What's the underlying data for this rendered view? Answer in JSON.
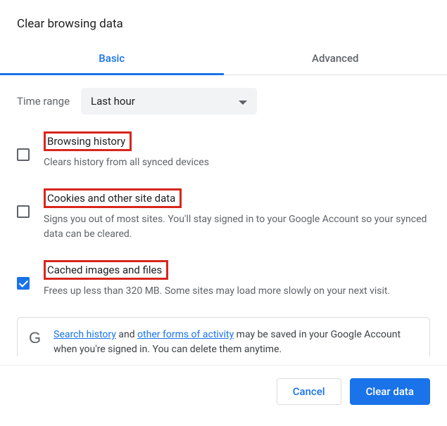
{
  "title": "Clear browsing data",
  "tabs": {
    "basic": "Basic",
    "advanced": "Advanced"
  },
  "timeRange": {
    "label": "Time range",
    "value": "Last hour"
  },
  "items": [
    {
      "title": "Browsing history",
      "desc": "Clears history from all synced devices",
      "checked": false
    },
    {
      "title": "Cookies and other site data",
      "desc": "Signs you out of most sites. You'll stay signed in to your Google Account so your synced data can be cleared.",
      "checked": false
    },
    {
      "title": "Cached images and files",
      "desc": "Frees up less than 320 MB. Some sites may load more slowly on your next visit.",
      "checked": true
    }
  ],
  "info": {
    "link1": "Search history",
    "mid1": " and ",
    "link2": "other forms of activity",
    "mid2": " may be saved in your Google Account when you're signed in. You can delete them anytime."
  },
  "buttons": {
    "cancel": "Cancel",
    "clear": "Clear data"
  }
}
